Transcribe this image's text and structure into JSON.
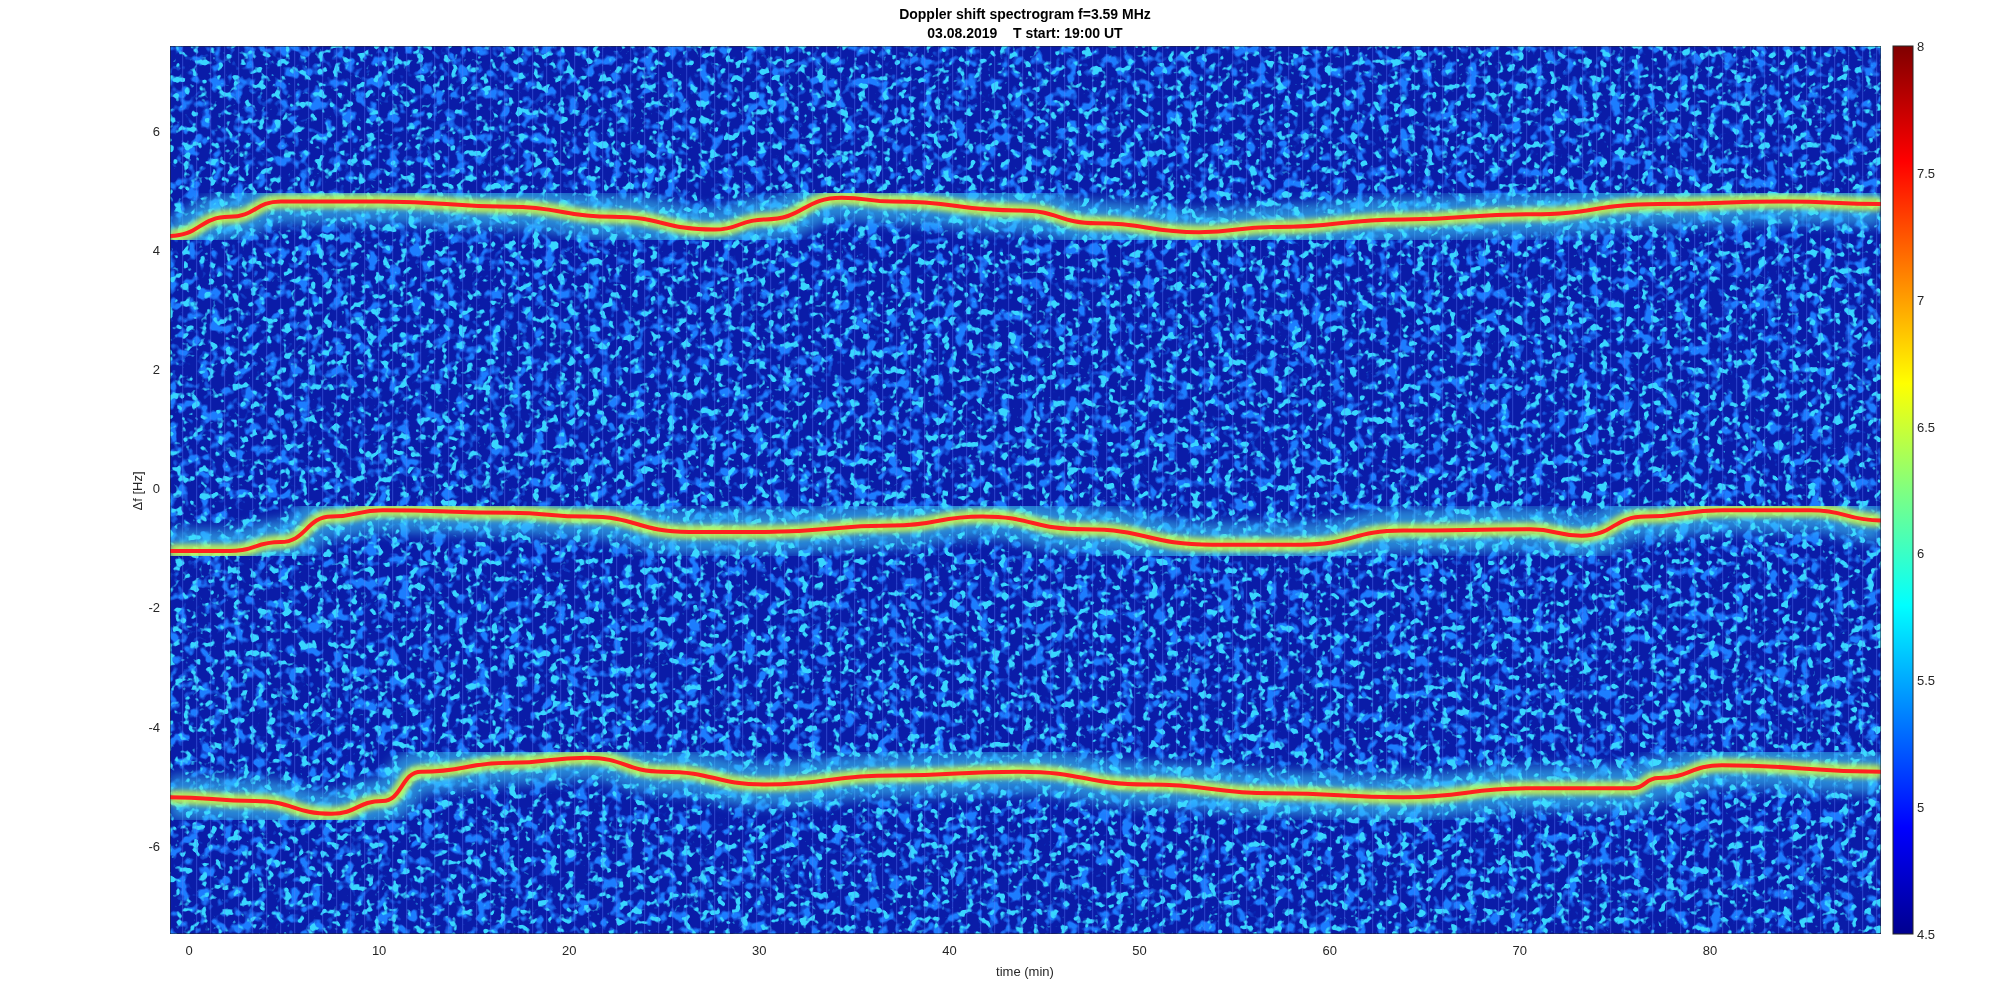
{
  "title": [
    "Doppler shift spectrogram f=3.59 MHz",
    "03.08.2019    T start: 19:00 UT"
  ],
  "x_axis": {
    "label": "time (min)",
    "ticks": [
      "0",
      "10",
      "20",
      "30",
      "40",
      "50",
      "60",
      "70",
      "80"
    ]
  },
  "y_axis": {
    "label": "Δf [Hz]",
    "ticks": [
      "6",
      "4",
      "2",
      "0",
      "-2",
      "-4",
      "-6"
    ]
  },
  "colorbar": {
    "ticks": [
      "8",
      "7.5",
      "7",
      "6.5",
      "6",
      "5.5",
      "5",
      "4.5"
    ]
  }
}
